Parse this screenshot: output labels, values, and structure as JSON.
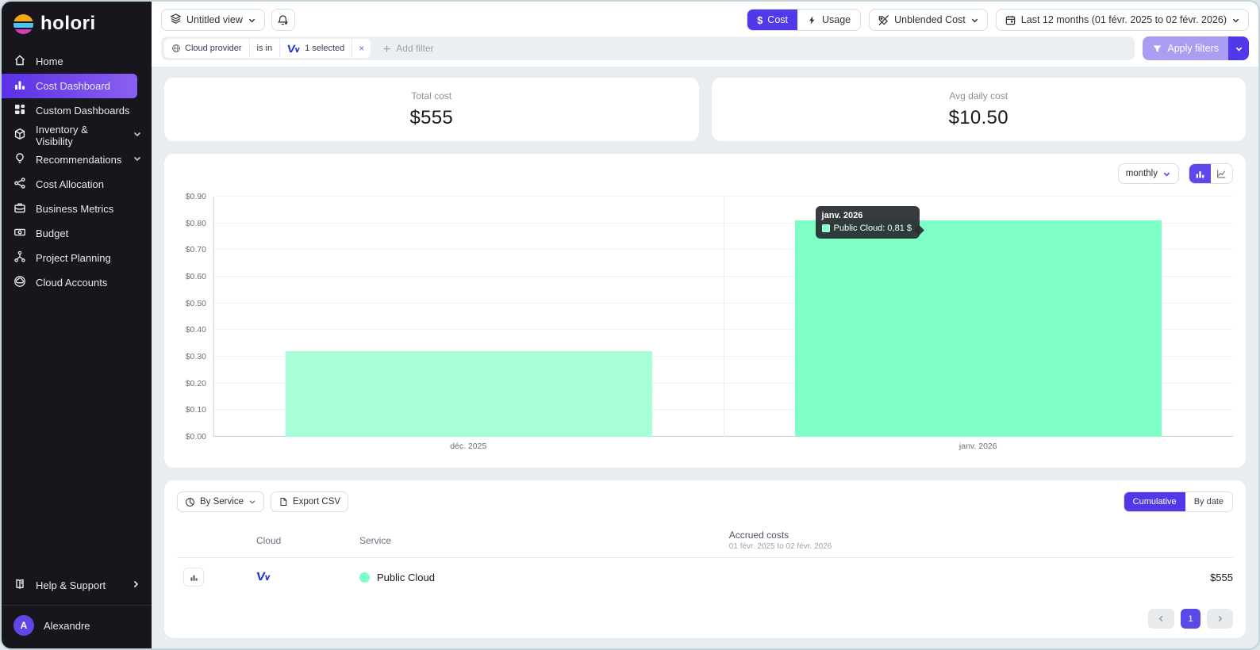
{
  "brand": {
    "name": "holori"
  },
  "sidebar": {
    "items": [
      {
        "label": "Home",
        "icon": "home",
        "active": false,
        "chevron": ""
      },
      {
        "label": "Cost Dashboard",
        "icon": "bar-chart",
        "active": true,
        "chevron": ""
      },
      {
        "label": "Custom Dashboards",
        "icon": "grid",
        "active": false,
        "chevron": ""
      },
      {
        "label": "Inventory & Visibility",
        "icon": "cube",
        "active": false,
        "chevron": "down"
      },
      {
        "label": "Recommendations",
        "icon": "lightbulb",
        "active": false,
        "chevron": "down"
      },
      {
        "label": "Cost Allocation",
        "icon": "share",
        "active": false,
        "chevron": ""
      },
      {
        "label": "Business Metrics",
        "icon": "briefcase",
        "active": false,
        "chevron": ""
      },
      {
        "label": "Budget",
        "icon": "banknote",
        "active": false,
        "chevron": ""
      },
      {
        "label": "Project Planning",
        "icon": "hierarchy",
        "active": false,
        "chevron": ""
      },
      {
        "label": "Cloud Accounts",
        "icon": "cloud",
        "active": false,
        "chevron": ""
      }
    ],
    "help_label": "Help & Support",
    "user": {
      "name": "Alexandre",
      "initial": "A"
    }
  },
  "header": {
    "view_selector": "Untitled view",
    "cost_label": "Cost",
    "usage_label": "Usage",
    "cost_type": "Unblended Cost",
    "date_range": "Last 12 months (01 févr. 2025 to 02 févr. 2026)"
  },
  "filters": {
    "chip_field": "Cloud provider",
    "chip_operator": "is in",
    "chip_value": "1 selected",
    "chip_remove": "×",
    "add_filter": "Add filter",
    "apply_label": "Apply filters"
  },
  "stats": [
    {
      "label": "Total cost",
      "value": "$555"
    },
    {
      "label": "Avg daily cost",
      "value": "$10.50"
    }
  ],
  "chart_controls": {
    "granularity": "monthly"
  },
  "chart_data": {
    "type": "bar",
    "title": "",
    "categories": [
      "déc. 2025",
      "janv. 2026"
    ],
    "series": [
      {
        "name": "Public Cloud",
        "values": [
          0.32,
          0.81
        ]
      }
    ],
    "bar_colors": [
      "#a6ffd9",
      "#7dffc6"
    ],
    "yticks": [
      "$0.00",
      "$0.10",
      "$0.20",
      "$0.30",
      "$0.40",
      "$0.50",
      "$0.60",
      "$0.70",
      "$0.80",
      "$0.90"
    ],
    "ylim": [
      0,
      0.9
    ],
    "grid": true,
    "legend": "none",
    "tooltip": {
      "title": "janv. 2026",
      "label": "Public Cloud: 0,81 $",
      "swatch_color": "#7dffc6"
    }
  },
  "table": {
    "group_by": "By Service",
    "export_label": "Export CSV",
    "mode_cumulative": "Cumulative",
    "mode_bydate": "By date",
    "col_cloud": "Cloud",
    "col_service": "Service",
    "col_accrued": "Accrued costs",
    "col_accrued_sub": "01 févr. 2025 to 02 févr. 2026",
    "rows": [
      {
        "service": "Public Cloud",
        "cost": "$555",
        "dot_color": "#7dffc6"
      }
    ],
    "pagination": {
      "current": "1"
    }
  },
  "colors": {
    "accent": "#5138e8",
    "accent_light": "#a99ef2",
    "sidebar_bg": "#17161d",
    "bar_default": "#a6ffd9",
    "bar_hover": "#7dffc6"
  }
}
